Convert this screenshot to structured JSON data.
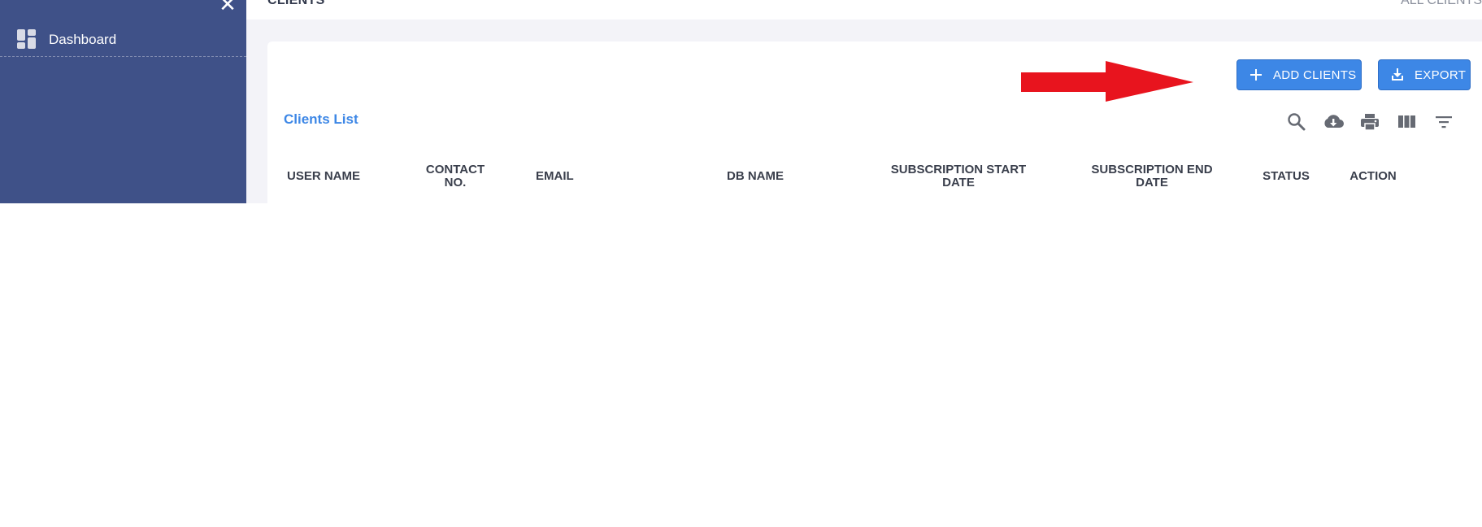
{
  "sidebar": {
    "close_icon": "close-icon",
    "items": [
      {
        "label": "Dashboard",
        "icon": "dashboard-icon"
      }
    ]
  },
  "header": {
    "title": "CLIENTS",
    "breadcrumb": "ALL CLIENTS"
  },
  "toolbar": {
    "add_label": "ADD CLIENTS",
    "export_label": "EXPORT",
    "icons": [
      "search-icon",
      "cloud-download-icon",
      "print-icon",
      "view-columns-icon",
      "filter-icon"
    ]
  },
  "list": {
    "title": "Clients List",
    "columns": [
      "USER NAME",
      "CONTACT NO.",
      "EMAIL",
      "DB NAME",
      "SUBSCRIPTION START DATE",
      "SUBSCRIPTION END DATE",
      "STATUS",
      "ACTION"
    ]
  },
  "colors": {
    "sidebar": "#3f5188",
    "primary": "#3d87e6",
    "arrow": "#e8141e",
    "background": "#f3f3f8"
  }
}
